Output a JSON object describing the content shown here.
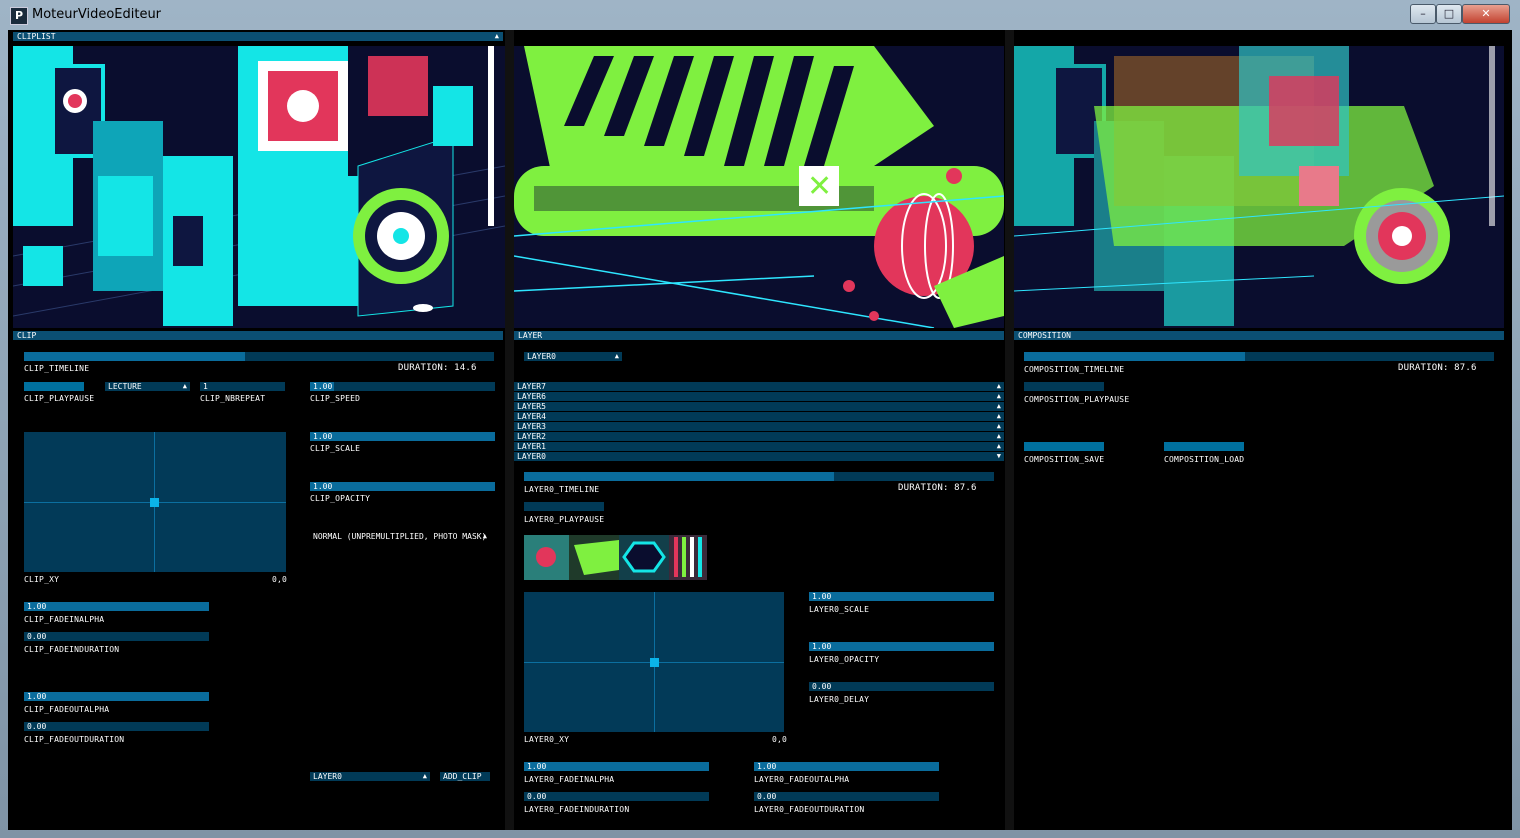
{
  "window": {
    "title": "MoteurVideoEditeur",
    "app_icon_letter": "P"
  },
  "clip": {
    "clip_list_label": "CLIPLIST",
    "panel_label": "CLIP",
    "timeline_label": "CLIP_TIMELINE",
    "duration_label": "DURATION: 14.6",
    "timeline_fill": 0.47,
    "playpause_label": "CLIP_PLAYPAUSE",
    "mode_value": "LECTURE",
    "nbrepeat_value": "1",
    "nbrepeat_label": "CLIP_NBREPEAT",
    "speed_value": "1.00",
    "speed_label": "CLIP_SPEED",
    "scale_value": "1.00",
    "scale_label": "CLIP_SCALE",
    "opacity_value": "1.00",
    "opacity_label": "CLIP_OPACITY",
    "blend_mode": "NORMAL (UNPREMULTIPLIED, PHOTO MASK)",
    "xy_label": "CLIP_XY",
    "xy_value": "0,0",
    "fadeinalpha_value": "1.00",
    "fadeinalpha_label": "CLIP_FADEINALPHA",
    "fadeinduration_value": "0.00",
    "fadeinduration_label": "CLIP_FADEINDURATION",
    "fadeoutalpha_value": "1.00",
    "fadeoutalpha_label": "CLIP_FADEOUTALPHA",
    "fadeoutduration_value": "0.00",
    "fadeoutduration_label": "CLIP_FADEOUTDURATION",
    "target_layer": "LAYER0",
    "add_clip_label": "ADD_CLIP"
  },
  "layer": {
    "panel_label": "LAYER",
    "selected_layer": "LAYER0",
    "layers": [
      "LAYER7",
      "LAYER6",
      "LAYER5",
      "LAYER4",
      "LAYER3",
      "LAYER2",
      "LAYER1",
      "LAYER0"
    ],
    "timeline_label": "LAYER0_TIMELINE",
    "duration_label": "DURATION: 87.6",
    "timeline_fill": 0.66,
    "playpause_label": "LAYER0_PLAYPAUSE",
    "xy_label": "LAYER0_XY",
    "xy_value": "0,0",
    "scale_value": "1.00",
    "scale_label": "LAYER0_SCALE",
    "opacity_value": "1.00",
    "opacity_label": "LAYER0_OPACITY",
    "delay_value": "0.00",
    "delay_label": "LAYER0_DELAY",
    "fadeinalpha_value": "1.00",
    "fadeinalpha_label": "LAYER0_FADEINALPHA",
    "fadeinduration_value": "0.00",
    "fadeinduration_label": "LAYER0_FADEINDURATION",
    "fadeoutalpha_value": "1.00",
    "fadeoutalpha_label": "LAYER0_FADEOUTALPHA",
    "fadeoutduration_value": "0.00",
    "fadeoutduration_label": "LAYER0_FADEOUTDURATION"
  },
  "composition": {
    "panel_label": "COMPOSITION",
    "timeline_label": "COMPOSITION_TIMELINE",
    "duration_label": "DURATION: 87.6",
    "timeline_fill": 0.47,
    "playpause_label": "COMPOSITION_PLAYPAUSE",
    "save_label": "COMPOSITION_SAVE",
    "load_label": "COMPOSITION_LOAD"
  },
  "colors": {
    "panel_header": "#0b4f73",
    "slider_bg": "#013a57",
    "slider_fill": "#0a6c9c",
    "accent": "#0bb3e8"
  }
}
